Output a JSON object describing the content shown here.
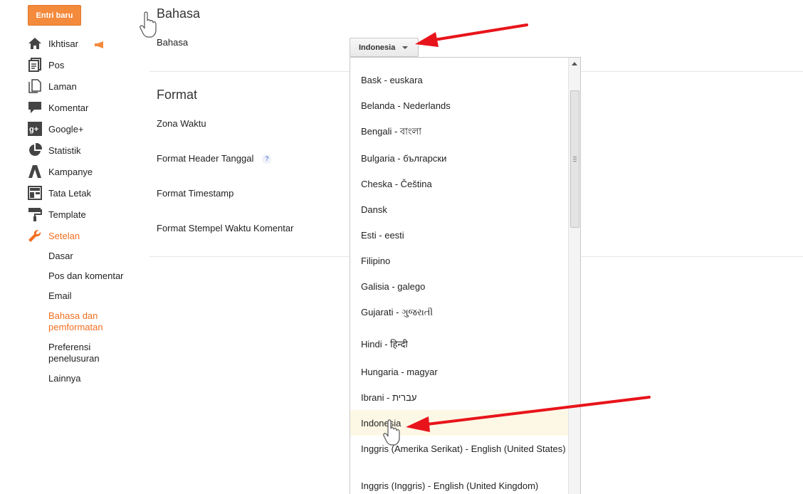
{
  "new_entry_label": "Entri baru",
  "accent_color": "#f36f21",
  "sidebar": {
    "items": [
      {
        "label": "Ikhtisar",
        "icon": "home-icon"
      },
      {
        "label": "Pos",
        "icon": "posts-icon"
      },
      {
        "label": "Laman",
        "icon": "pages-icon"
      },
      {
        "label": "Komentar",
        "icon": "comment-icon"
      },
      {
        "label": "Google+",
        "icon": "google-plus-icon"
      },
      {
        "label": "Statistik",
        "icon": "pie-chart-icon"
      },
      {
        "label": "Kampanye",
        "icon": "adwords-icon"
      },
      {
        "label": "Tata Letak",
        "icon": "layout-icon"
      },
      {
        "label": "Template",
        "icon": "paint-roller-icon"
      },
      {
        "label": "Setelan",
        "icon": "wrench-icon"
      }
    ],
    "subitems": [
      {
        "label": "Dasar"
      },
      {
        "label": "Pos dan komentar"
      },
      {
        "label": "Email"
      },
      {
        "label": "Bahasa dan pemformatan"
      },
      {
        "label": "Preferensi penelusuran"
      },
      {
        "label": "Lainnya"
      }
    ]
  },
  "main": {
    "bahasa_heading": "Bahasa",
    "bahasa_label": "Bahasa",
    "bahasa_selected": "Indonesia",
    "format_heading": "Format",
    "zona_waktu_label": "Zona Waktu",
    "format_header_label": "Format Header Tanggal",
    "help_glyph": "?",
    "format_timestamp_label": "Format Timestamp",
    "format_stempel_label": "Format Stempel Waktu Komentar"
  },
  "dropdown": {
    "options": [
      {
        "label": "Bask - euskara"
      },
      {
        "label": "Belanda - Nederlands"
      },
      {
        "label": "Bengali - বাংলা"
      },
      {
        "label": "Bulgaria - български"
      },
      {
        "label": "Cheska - Čeština"
      },
      {
        "label": "Dansk"
      },
      {
        "label": "Esti - eesti"
      },
      {
        "label": "Filipino"
      },
      {
        "label": "Galisia - galego"
      },
      {
        "label": "Gujarati - ગુજરાતી"
      },
      {
        "label": "Hindi - हिन्दी"
      },
      {
        "label": "Hungaria - magyar"
      },
      {
        "label": "Ibrani - עברית"
      },
      {
        "label": "Indonesia"
      },
      {
        "label": "Inggris (Amerika Serikat) - English (United States)"
      },
      {
        "label": "Inggris (Inggris) - English (United Kingdom)"
      }
    ]
  },
  "annotation_color": "#e8141b"
}
